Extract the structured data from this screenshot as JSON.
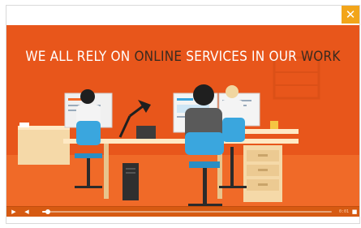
{
  "player": {
    "close_glyph": "✕",
    "headline": [
      {
        "text": "WE ALL RELY ON ",
        "color": "#ffffff"
      },
      {
        "text": "ONLINE",
        "color": "#3a2a1f"
      },
      {
        "text": " SERVICES IN OUR ",
        "color": "#ffffff"
      },
      {
        "text": "WORK",
        "color": "#3a2a1f"
      }
    ],
    "controls": {
      "play_icon": "▶",
      "volume_icon": "◀",
      "fullscreen_icon": "■",
      "time": "0:01",
      "progress": 0.02
    }
  },
  "colors": {
    "background": "#e8561b",
    "floor": "#f26b2a",
    "close_bg": "#f2a51a",
    "chair": "#3aa6de",
    "desk": "#f5d9a8"
  }
}
